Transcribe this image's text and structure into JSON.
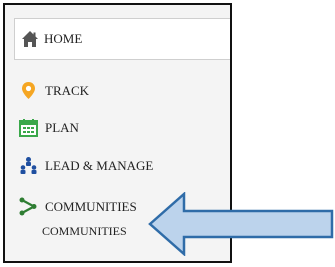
{
  "nav": {
    "home": {
      "label": "HOME",
      "icon": "home-icon"
    },
    "items": [
      {
        "label": "TRACK",
        "icon": "location-pin-icon",
        "color": "#f5a623"
      },
      {
        "label": "PLAN",
        "icon": "calendar-icon",
        "color": "#3aa84a"
      },
      {
        "label": "LEAD & MANAGE",
        "icon": "org-chart-icon",
        "color": "#1f4fa0"
      },
      {
        "label": "COMMUNITIES",
        "icon": "share-nodes-icon",
        "color": "#2e7d32"
      }
    ],
    "sub_items": [
      {
        "label": "COMMUNITIES"
      }
    ]
  },
  "annotation": {
    "type": "callout-arrow",
    "fill": "#bcd3ec",
    "stroke": "#2f6ca8"
  }
}
